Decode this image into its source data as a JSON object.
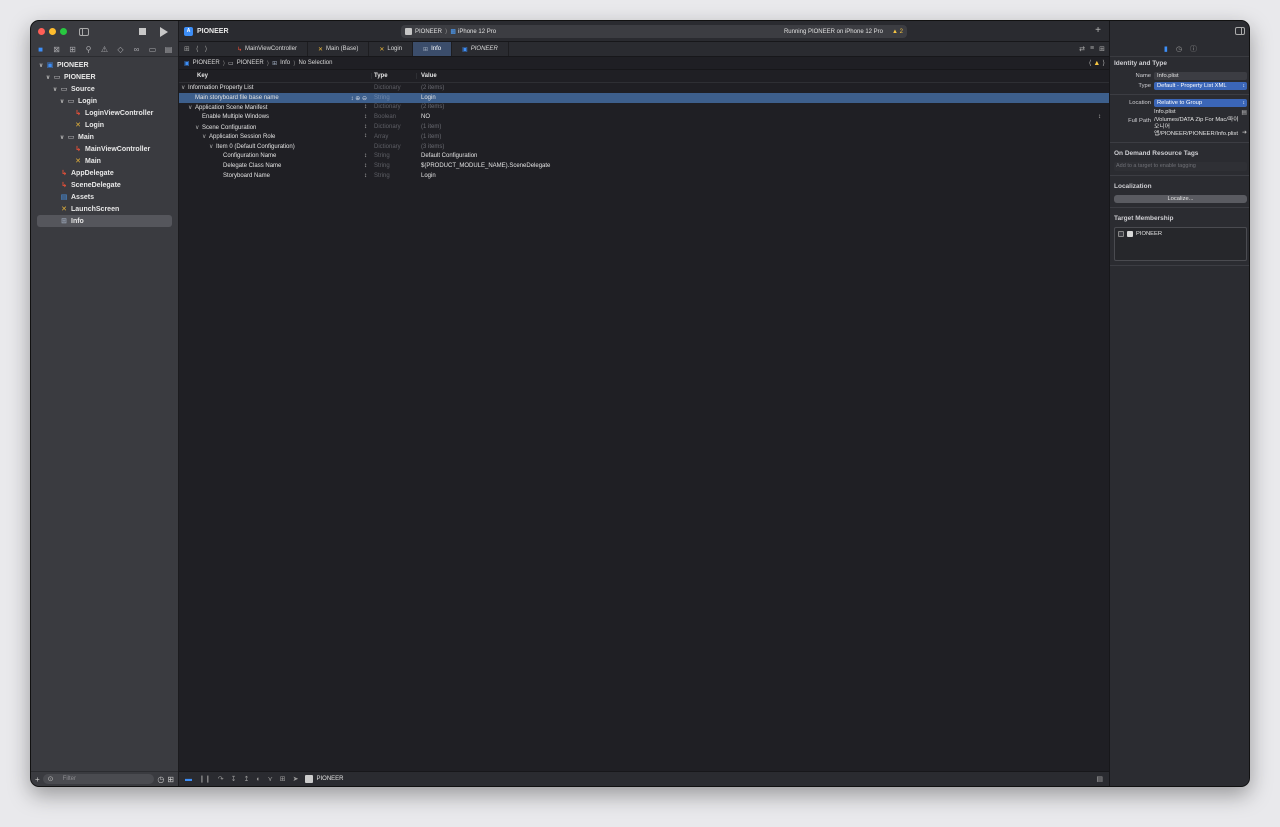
{
  "toolbar": {
    "project": "PIONEER",
    "scheme": "PIONEER",
    "device": "iPhone 12 Pro",
    "status": "Running PIONEER on iPhone 12 Pro",
    "warnings": "2"
  },
  "navigator": {
    "filter_placeholder": "Filter",
    "items": [
      {
        "label": "PIONEER",
        "depth": 0,
        "chev": "v",
        "icon": "project-icon"
      },
      {
        "label": "PIONEER",
        "depth": 1,
        "chev": "v",
        "icon": "folder-icon"
      },
      {
        "label": "Source",
        "depth": 2,
        "chev": "v",
        "icon": "folder-icon"
      },
      {
        "label": "Login",
        "depth": 3,
        "chev": "v",
        "icon": "folder-icon"
      },
      {
        "label": "LoginViewController",
        "depth": 4,
        "chev": "",
        "icon": "swift-icon"
      },
      {
        "label": "Login",
        "depth": 4,
        "chev": "",
        "icon": "storyboard-icon"
      },
      {
        "label": "Main",
        "depth": 3,
        "chev": "v",
        "icon": "folder-icon"
      },
      {
        "label": "MainViewController",
        "depth": 4,
        "chev": "",
        "icon": "swift-icon"
      },
      {
        "label": "Main",
        "depth": 4,
        "chev": "",
        "icon": "storyboard-icon"
      },
      {
        "label": "AppDelegate",
        "depth": 2,
        "chev": "",
        "icon": "swift-icon"
      },
      {
        "label": "SceneDelegate",
        "depth": 2,
        "chev": "",
        "icon": "swift-icon"
      },
      {
        "label": "Assets",
        "depth": 2,
        "chev": "",
        "icon": "assets-icon"
      },
      {
        "label": "LaunchScreen",
        "depth": 2,
        "chev": "",
        "icon": "storyboard-icon"
      },
      {
        "label": "Info",
        "depth": 2,
        "chev": "",
        "icon": "plist-icon",
        "selected": true
      }
    ]
  },
  "tabs": [
    {
      "label": "MainViewController",
      "icon": "swift-icon"
    },
    {
      "label": "Main (Base)",
      "icon": "storyboard-icon"
    },
    {
      "label": "Login",
      "icon": "storyboard-icon"
    },
    {
      "label": "Info",
      "icon": "plist-icon",
      "active": true
    },
    {
      "label": "PIONEER",
      "icon": "project-icon",
      "italic": true
    }
  ],
  "breadcrumb": [
    "PIONEER",
    "PIONEER",
    "Info",
    "No Selection"
  ],
  "plist": {
    "headers": {
      "key": "Key",
      "type": "Type",
      "value": "Value"
    },
    "rows": [
      {
        "key": "Information Property List",
        "type": "Dictionary",
        "value": "(2 items)",
        "indent": 0,
        "chev": "v",
        "dim": true
      },
      {
        "key": "Main storyboard file base name",
        "type": "String",
        "value": "Login",
        "indent": 1,
        "chev": "",
        "selected": true
      },
      {
        "key": "Application Scene Manifest",
        "type": "Dictionary",
        "value": "(2 items)",
        "indent": 1,
        "chev": "v",
        "dim": true
      },
      {
        "key": "Enable Multiple Windows",
        "type": "Boolean",
        "value": "NO",
        "indent": 2,
        "chev": ""
      },
      {
        "key": "Scene Configuration",
        "type": "Dictionary",
        "value": "(1 item)",
        "indent": 2,
        "chev": "v",
        "dim": true
      },
      {
        "key": "Application Session Role",
        "type": "Array",
        "value": "(1 item)",
        "indent": 3,
        "chev": "v",
        "dim": true
      },
      {
        "key": "Item 0 (Default Configuration)",
        "type": "Dictionary",
        "value": "(3 items)",
        "indent": 4,
        "chev": "v",
        "dim": true
      },
      {
        "key": "Configuration Name",
        "type": "String",
        "value": "Default Configuration",
        "indent": 5,
        "chev": ""
      },
      {
        "key": "Delegate Class Name",
        "type": "String",
        "value": "$(PRODUCT_MODULE_NAME).SceneDelegate",
        "indent": 5,
        "chev": ""
      },
      {
        "key": "Storyboard Name",
        "type": "String",
        "value": "Login",
        "indent": 5,
        "chev": ""
      }
    ]
  },
  "debugbar": {
    "scheme": "PIONEER"
  },
  "inspector": {
    "identity_title": "Identity and Type",
    "name_label": "Name",
    "name_value": "Info.plist",
    "type_label": "Type",
    "type_value": "Default - Property List XML",
    "location_label": "Location",
    "location_value": "Relative to Group",
    "file_name": "Info.plist",
    "full_path_label": "Full Path",
    "full_path_value": "/Volumes/DATA Zip For Mac/파이오니어 앱/PIONEER/PIONEER/Info.plist",
    "tags_title": "On Demand Resource Tags",
    "tags_placeholder": "Add to a target to enable tagging",
    "localization_title": "Localization",
    "localize_button": "Localize...",
    "membership_title": "Target Membership",
    "membership_target": "PIONEER"
  },
  "colors": {
    "accent": "#3d8ef7",
    "selection": "#3d5f8c",
    "warning": "#f5c542"
  }
}
